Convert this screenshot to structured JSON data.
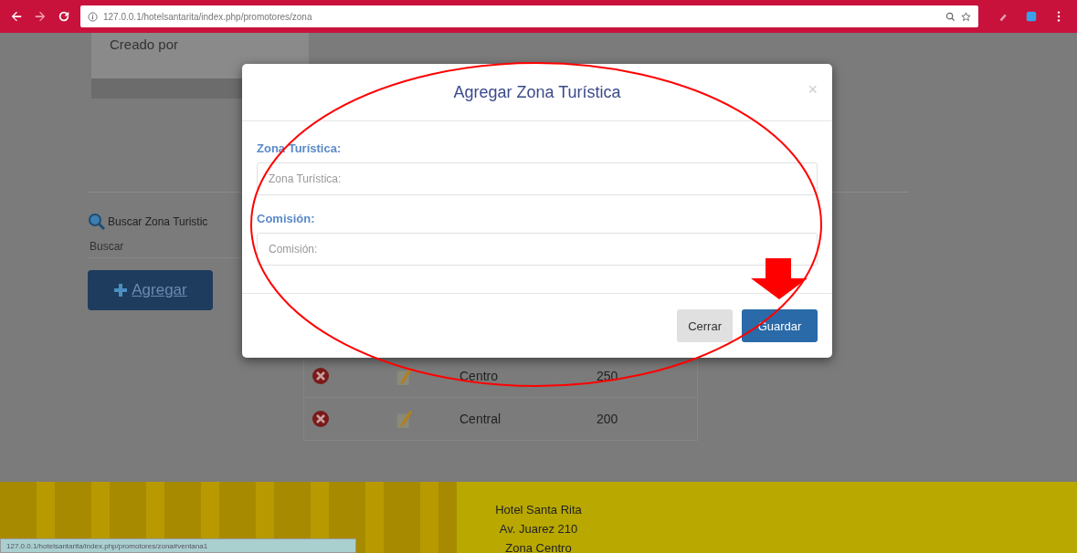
{
  "browser": {
    "url": "127.0.0.1/hotelsantarita/index.php/promotores/zona"
  },
  "page": {
    "panel_heading": "Creado por",
    "search_label": "Buscar Zona Turistic",
    "search": {
      "placeholder": "Buscar"
    },
    "add_button": "Agregar",
    "table": {
      "rows": [
        {
          "column_3": "Centro",
          "column_4": "250"
        },
        {
          "column_3": "Central",
          "column_4": "200"
        }
      ]
    }
  },
  "modal": {
    "title": "Agregar Zona Turística",
    "close": "×",
    "fields": [
      {
        "label": "Zona Turística:",
        "placeholder": "Zona Turística:"
      },
      {
        "label": "Comisión:",
        "placeholder": "Comisión:"
      }
    ],
    "buttons": [
      {
        "label": "Cerrar",
        "kind": "default"
      },
      {
        "label": "Guardar",
        "kind": "primary"
      }
    ]
  },
  "footer": {
    "lines": [
      "Hotel Santa Rita",
      "Av. Juarez 210",
      "Zona Centro"
    ]
  },
  "status_bar": {
    "url": "127.0.0.1/hotelsantarita/index.php/promotores/zona#ventana1"
  }
}
